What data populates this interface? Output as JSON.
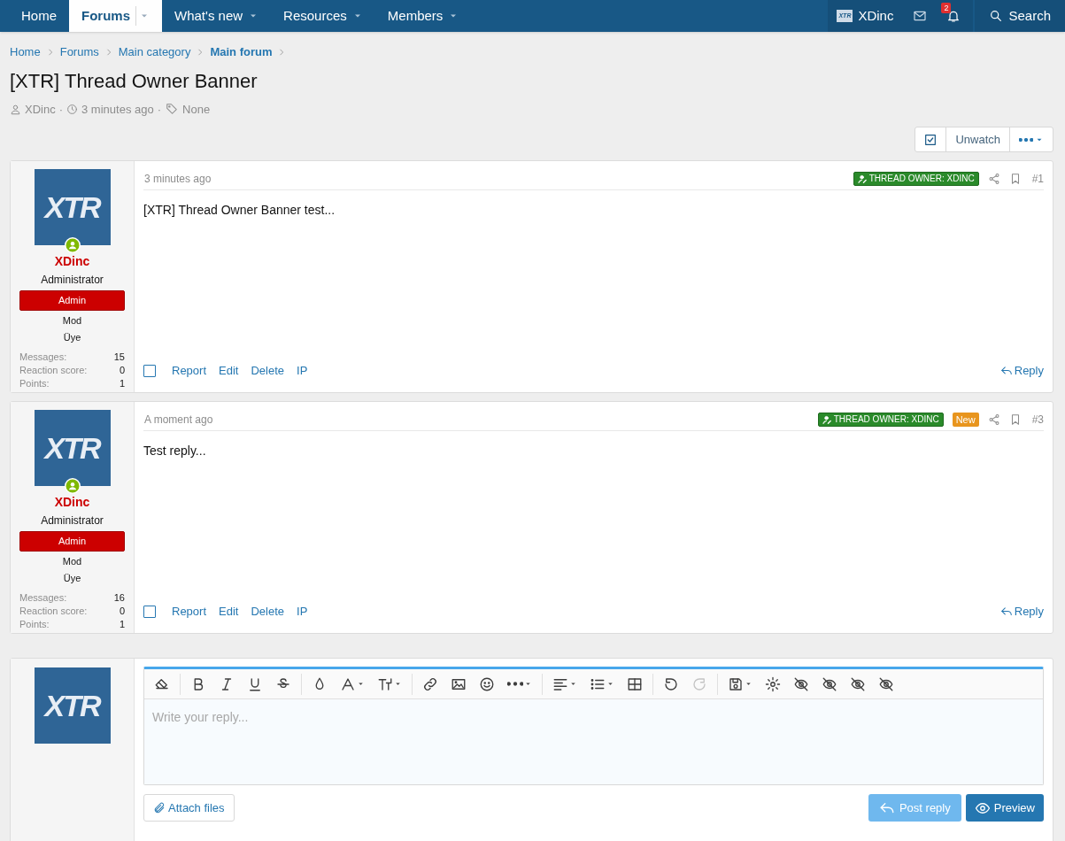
{
  "nav": {
    "items": [
      {
        "label": "Home",
        "selected": false,
        "dropdown": false
      },
      {
        "label": "Forums",
        "selected": true,
        "dropdown": true
      },
      {
        "label": "What's new",
        "selected": false,
        "dropdown": true
      },
      {
        "label": "Resources",
        "selected": false,
        "dropdown": true
      },
      {
        "label": "Members",
        "selected": false,
        "dropdown": true
      }
    ],
    "user": {
      "avatar_text": "XTR",
      "name": "XDinc"
    },
    "alerts_count": "2",
    "search": "Search"
  },
  "breadcrumbs": [
    {
      "label": "Home",
      "current": false
    },
    {
      "label": "Forums",
      "current": false
    },
    {
      "label": "Main category",
      "current": false
    },
    {
      "label": "Main forum",
      "current": true
    }
  ],
  "thread": {
    "title": "[XTR] Thread Owner Banner",
    "author": "XDinc",
    "separators": [
      "·",
      "·"
    ],
    "time": "3 minutes ago",
    "tags": "None"
  },
  "thread_actions": {
    "watch_label": "Unwatch",
    "watched": true
  },
  "posts": [
    {
      "avatar_text": "XTR",
      "online": true,
      "author": "XDinc",
      "user_title": "Administrator",
      "banners": [
        {
          "label": "Admin",
          "kind": "badge"
        },
        {
          "label": "Mod",
          "kind": "plain"
        },
        {
          "label": "Üye",
          "kind": "plain"
        }
      ],
      "stats": [
        {
          "label": "Messages:",
          "value": "15"
        },
        {
          "label": "Reaction score:",
          "value": "0"
        },
        {
          "label": "Points:",
          "value": "1"
        }
      ],
      "time": "3 minutes ago",
      "owner_banner": "THREAD OWNER: XDINC",
      "number": "#1",
      "body": "[XTR] Thread Owner Banner test...",
      "selected": false,
      "actions": [
        "Report",
        "Edit",
        "Delete",
        "IP"
      ],
      "reply": "Reply"
    },
    {
      "avatar_text": "XTR",
      "online": true,
      "author": "XDinc",
      "user_title": "Administrator",
      "banners": [
        {
          "label": "Admin",
          "kind": "badge"
        },
        {
          "label": "Mod",
          "kind": "plain"
        },
        {
          "label": "Üye",
          "kind": "plain"
        }
      ],
      "stats": [
        {
          "label": "Messages:",
          "value": "16"
        },
        {
          "label": "Reaction score:",
          "value": "0"
        },
        {
          "label": "Points:",
          "value": "1"
        }
      ],
      "time": "A moment ago",
      "owner_banner": "THREAD OWNER: XDINC",
      "new_label": "New",
      "number": "#3",
      "body": "Test reply...",
      "selected": false,
      "actions": [
        "Report",
        "Edit",
        "Delete",
        "IP"
      ],
      "reply": "Reply"
    }
  ],
  "editor": {
    "avatar_text": "XTR",
    "placeholder": "Write your reply...",
    "toolbar": [
      [
        {
          "disabled": false,
          "dropdown": false
        }
      ],
      [
        {
          "disabled": false,
          "dropdown": false
        },
        {
          "disabled": false,
          "dropdown": false
        },
        {
          "disabled": false,
          "dropdown": false
        },
        {
          "disabled": false,
          "dropdown": false
        }
      ],
      [
        {
          "disabled": false,
          "dropdown": false
        },
        {
          "disabled": false,
          "dropdown": true
        },
        {
          "disabled": false,
          "dropdown": true
        }
      ],
      [
        {
          "disabled": false,
          "dropdown": false
        },
        {
          "disabled": false,
          "dropdown": false
        },
        {
          "disabled": false,
          "dropdown": false
        },
        {
          "disabled": false,
          "dropdown": true
        }
      ],
      [
        {
          "disabled": false,
          "dropdown": true
        },
        {
          "disabled": false,
          "dropdown": true
        },
        {
          "disabled": false,
          "dropdown": false
        }
      ],
      [
        {
          "disabled": false,
          "dropdown": false
        },
        {
          "disabled": true,
          "dropdown": false
        }
      ],
      [
        {
          "disabled": false,
          "dropdown": true
        },
        {
          "disabled": false,
          "dropdown": false
        },
        {
          "disabled": false,
          "dropdown": false
        },
        {
          "disabled": false,
          "dropdown": false
        },
        {
          "disabled": false,
          "dropdown": false
        },
        {
          "disabled": false,
          "dropdown": false
        }
      ]
    ],
    "attach": "Attach files",
    "post": "Post reply",
    "post_disabled": true,
    "preview": "Preview"
  }
}
